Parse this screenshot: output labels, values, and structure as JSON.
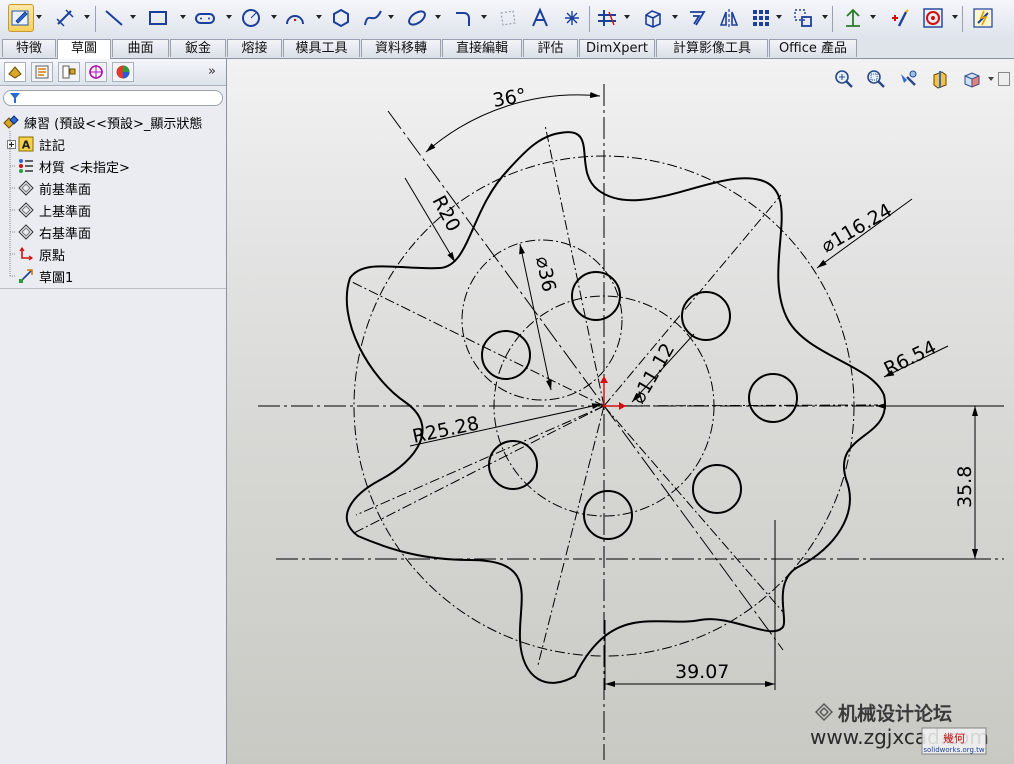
{
  "menu_tabs": [
    "特徵",
    "草圖",
    "曲面",
    "鈑金",
    "熔接",
    "模具工具",
    "資料移轉",
    "直接編輯",
    "評估",
    "DimXpert",
    "計算影像工具",
    "Office 產品"
  ],
  "active_tab": "草圖",
  "toolbar_icons": [
    "sketch-icon",
    "smart-dimension-icon",
    "line-icon",
    "rectangle-icon",
    "slot-icon",
    "circle-icon",
    "arc-icon",
    "polygon-icon",
    "spline-icon",
    "ellipse-icon",
    "fillet-icon",
    "plane-icon",
    "text-icon",
    "point-icon",
    "trim-icon",
    "offset-icon",
    "convert-icon",
    "mirror-icon",
    "linear-pattern-icon",
    "move-icon",
    "display-relations-icon",
    "repair-icon",
    "rapid-sketch-icon",
    "instant2d-icon",
    "sketch-check-icon"
  ],
  "panel_tabs": [
    "feature-manager-icon",
    "property-manager-icon",
    "configuration-manager-icon",
    "dimxpert-icon",
    "display-manager-icon"
  ],
  "panel_expand": "»",
  "tree": [
    {
      "label": "練習  (預設<<預設>_顯示狀態",
      "icon": "part-icon"
    },
    {
      "label": "註記",
      "icon": "annotations-icon"
    },
    {
      "label": "材質 <未指定>",
      "icon": "material-icon"
    },
    {
      "label": "前基準面",
      "icon": "plane-icon"
    },
    {
      "label": "上基準面",
      "icon": "plane-icon"
    },
    {
      "label": "右基準面",
      "icon": "plane-icon"
    },
    {
      "label": "原點",
      "icon": "origin-icon"
    },
    {
      "label": "草圖1",
      "icon": "sketch-icon"
    }
  ],
  "view_icons": [
    "zoom-to-fit-icon",
    "zoom-area-icon",
    "previous-view-icon",
    "section-view-icon",
    "view-orientation-icon"
  ],
  "dimensions": {
    "angle": "36°",
    "r20": "R20",
    "d36": "⌀36",
    "d116": "⌀116.24",
    "d11": "⌀11.12",
    "r654": "R6.54",
    "r2528": "R25.28",
    "v358": "35.8",
    "h3907": "39.07"
  },
  "watermark": {
    "site_cn": "机械设计论坛",
    "url": "www.zgjxcad.com",
    "badge": "幾何",
    "badge_url": "solidworks.org.tw"
  },
  "colors": {
    "accent": "#f7cf5c",
    "line": "#000000",
    "origin": "#d01010"
  }
}
